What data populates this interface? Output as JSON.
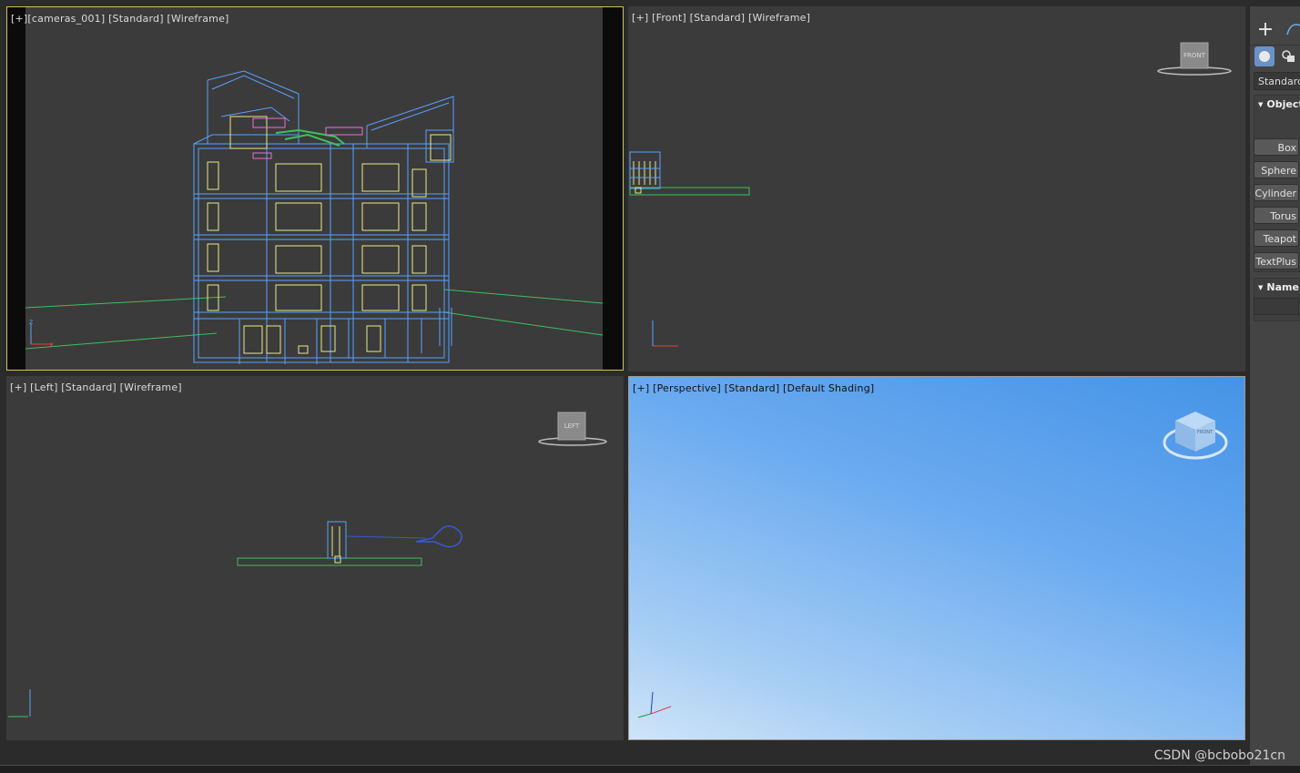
{
  "viewports": {
    "camera": {
      "plus": "[+]",
      "view": "[cameras_001]",
      "mode": "[Standard]",
      "shading": "[Wireframe]"
    },
    "front": {
      "plus": "[+]",
      "view": "[Front]",
      "mode": "[Standard]",
      "shading": "[Wireframe]",
      "cube_label": "FRONT"
    },
    "left": {
      "plus": "[+]",
      "view": "[Left]",
      "mode": "[Standard]",
      "shading": "[Wireframe]",
      "cube_label": "LEFT"
    },
    "perspective": {
      "plus": "[+]",
      "view": "[Perspective]",
      "mode": "[Standard]",
      "shading": "[Default Shading]",
      "cube_label": "FRONT"
    }
  },
  "axes": {
    "x": "x",
    "y": "y",
    "z": "z"
  },
  "command_panel": {
    "primitive_type": "Standard",
    "object_type_header": "Object Type",
    "buttons": [
      "Box",
      "Sphere",
      "Cylinder",
      "Torus",
      "Teapot",
      "TextPlus"
    ],
    "name_header": "Name and Color"
  },
  "colors": {
    "viewport_bg": "#3b3b3b",
    "active_border": "#cfc35a",
    "wire_blue": "#5aa0ff",
    "wire_yellow": "#e9e98a",
    "wire_green": "#3fbf5f",
    "wire_magenta": "#e070d8"
  },
  "watermark": "CSDN @bcbobo21cn"
}
